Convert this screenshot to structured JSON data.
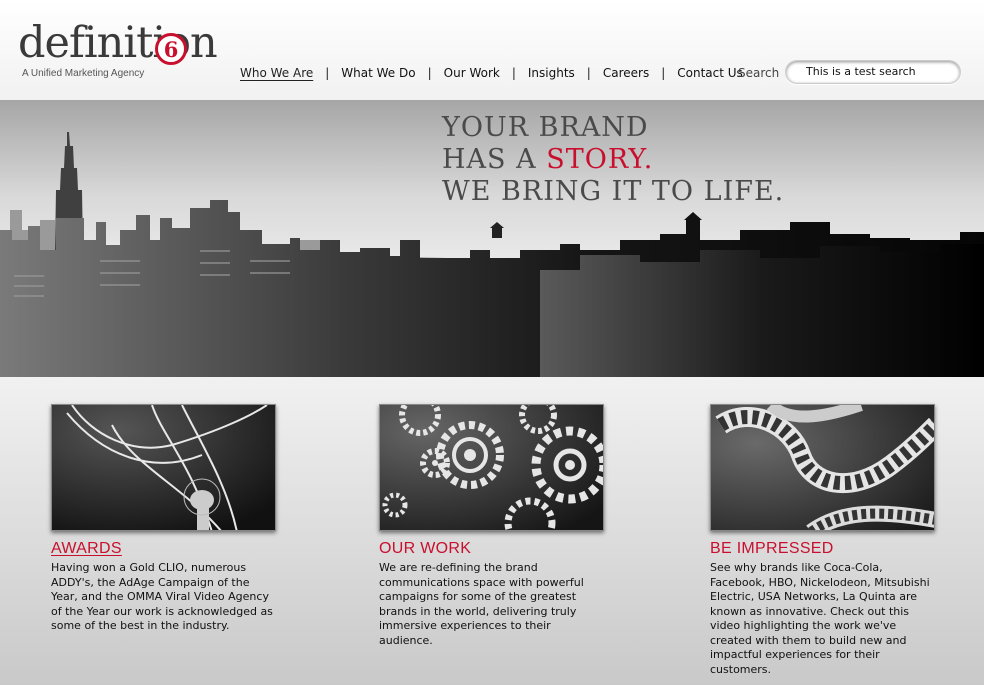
{
  "brand": {
    "logo_text": "definition",
    "logo_mark": "6",
    "tagline": "A Unified Marketing Agency"
  },
  "nav": {
    "items": [
      {
        "label": "Who We Are",
        "active": true
      },
      {
        "label": "What We Do"
      },
      {
        "label": "Our Work"
      },
      {
        "label": "Insights"
      },
      {
        "label": "Careers"
      },
      {
        "label": "Contact Us"
      }
    ],
    "separator": "|"
  },
  "search": {
    "label": "Search",
    "value": "This is a test search"
  },
  "hero": {
    "line1": "YOUR BRAND",
    "line2_prefix": "HAS A ",
    "line2_highlight": "STORY.",
    "line3": "WE BRING IT TO LIFE."
  },
  "sections": [
    {
      "title": "AWARDS",
      "icon": "trophy-statue-icon",
      "text": "Having won a Gold CLIO, numerous ADDY's, the AdAge Campaign of the Year, and the OMMA Viral Video Agency of the Year our work is acknowledged as some of the best in the industry."
    },
    {
      "title": "OUR WORK",
      "icon": "gears-icon",
      "text": "We are re-defining the brand communications space with powerful campaigns for some of the greatest brands in the world, delivering truly immersive experiences to their audience."
    },
    {
      "title": "BE IMPRESSED",
      "icon": "film-reel-icon",
      "text": "See why brands like Coca-Cola, Facebook, HBO, Nickelodeon, Mitsubishi Electric, USA Networks, La Quinta are known as innovative. Check out this video highlighting the work we've created with them to build new and impactful experiences for their customers."
    }
  ],
  "colors": {
    "accent": "#c8102e",
    "text": "#111111"
  }
}
